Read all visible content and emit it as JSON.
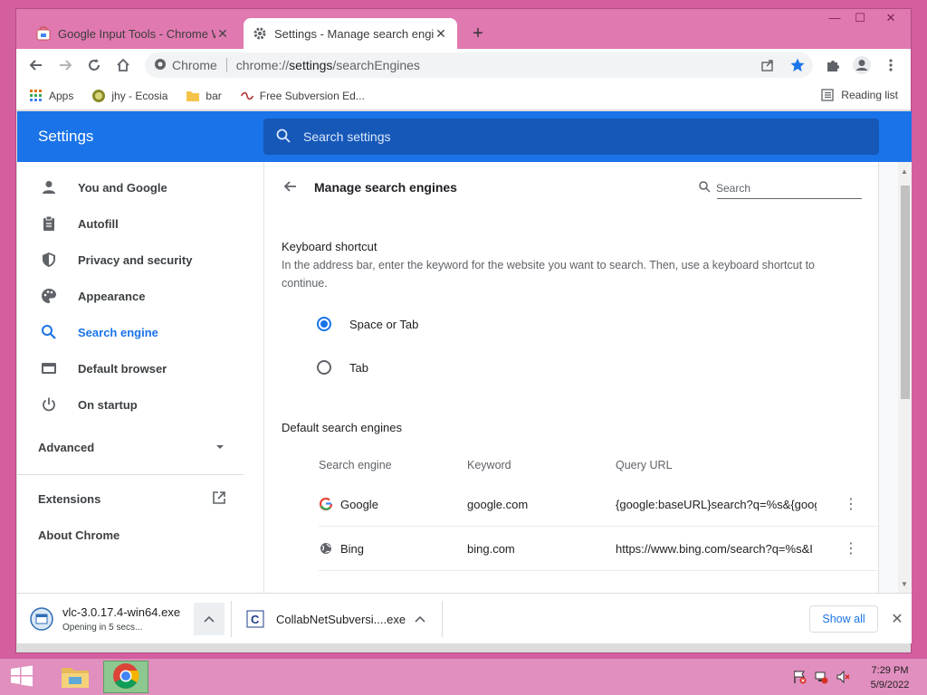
{
  "browser": {
    "tabs": [
      {
        "title": "Google Input Tools - Chrome We",
        "active": false
      },
      {
        "title": "Settings - Manage search engine",
        "active": true
      }
    ],
    "new_tab": "+",
    "window_controls": {
      "minimize": "—",
      "maximize": "☐",
      "close": "✕"
    },
    "omnibox": {
      "site": "Chrome",
      "url_prefix": "chrome://",
      "url_host": "settings",
      "url_path": "/searchEngines"
    },
    "bookmarks": [
      {
        "label": "Apps",
        "icon": "apps-grid-icon"
      },
      {
        "label": "jhy - Ecosia",
        "icon": "ecosia-icon"
      },
      {
        "label": "bar",
        "icon": "folder-icon"
      },
      {
        "label": "Free Subversion Ed...",
        "icon": "subversion-icon"
      }
    ],
    "reading_list": "Reading list"
  },
  "settings": {
    "title": "Settings",
    "search_placeholder": "Search settings",
    "nav": [
      {
        "label": "You and Google",
        "icon": "person-icon"
      },
      {
        "label": "Autofill",
        "icon": "clipboard-icon"
      },
      {
        "label": "Privacy and security",
        "icon": "shield-icon"
      },
      {
        "label": "Appearance",
        "icon": "palette-icon"
      },
      {
        "label": "Search engine",
        "icon": "search-icon",
        "selected": true
      },
      {
        "label": "Default browser",
        "icon": "browser-window-icon"
      },
      {
        "label": "On startup",
        "icon": "power-icon"
      }
    ],
    "advanced": "Advanced",
    "extensions": "Extensions",
    "about": "About Chrome"
  },
  "page": {
    "title": "Manage search engines",
    "search_placeholder": "Search",
    "keyboard_shortcut": {
      "heading": "Keyboard shortcut",
      "description": "In the address bar, enter the keyword for the website you want to search. Then, use a keyboard shortcut to continue.",
      "options": [
        {
          "label": "Space or Tab",
          "selected": true
        },
        {
          "label": "Tab",
          "selected": false
        }
      ]
    },
    "default_engines": {
      "heading": "Default search engines",
      "columns": [
        "Search engine",
        "Keyword",
        "Query URL"
      ],
      "rows": [
        {
          "engine": "Google",
          "keyword": "google.com",
          "url": "{google:baseURL}search?q=%s&{goog",
          "icon": "google-g-icon"
        },
        {
          "engine": "Bing",
          "keyword": "bing.com",
          "url": "https://www.bing.com/search?q=%s&I",
          "icon": "globe-icon"
        }
      ]
    }
  },
  "downloads": [
    {
      "name": "vlc-3.0.17.4-win64.exe",
      "status": "Opening in 5 secs...",
      "icon": "vlc-installer-icon"
    },
    {
      "name": "CollabNetSubversi....exe",
      "status": "",
      "icon": "collabnet-icon"
    }
  ],
  "show_all": "Show all",
  "taskbar": {
    "time": "7:29 PM",
    "date": "5/9/2022"
  },
  "colors": {
    "accent": "#1a73e8",
    "header": "#1a73e8",
    "desktop": "#d35f9f"
  }
}
